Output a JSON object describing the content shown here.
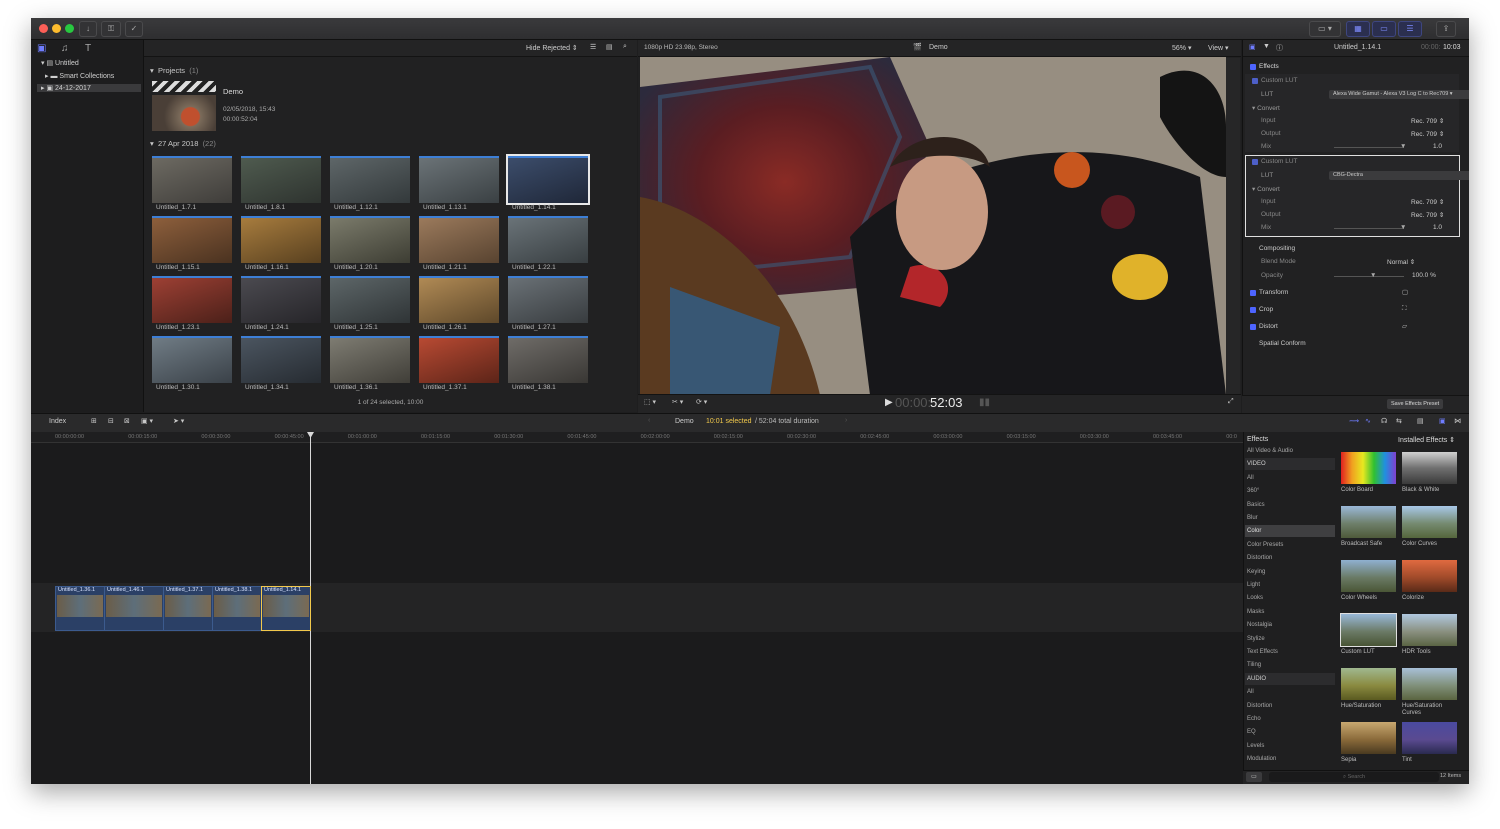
{
  "window": {
    "title": ""
  },
  "toolbar": {
    "import_icon": "download-icon",
    "keyword_icon": "key-icon",
    "check_icon": "checkmark-icon"
  },
  "library": {
    "items": [
      {
        "label": "Untitled"
      },
      {
        "label": "Smart Collections"
      },
      {
        "label": "24-12-2017"
      }
    ]
  },
  "browser": {
    "filter_label": "Hide Rejected",
    "projects_label": "Projects",
    "projects_count": "(1)",
    "project": {
      "name": "Demo",
      "date": "02/05/2018, 15:43",
      "duration": "00:00:52:04"
    },
    "date_group": "27 Apr 2018",
    "date_count": "(22)",
    "clips": [
      "Untitled_1.7.1",
      "Untitled_1.8.1",
      "Untitled_1.12.1",
      "Untitled_1.13.1",
      "Untitled_1.14.1",
      "Untitled_1.15.1",
      "Untitled_1.16.1",
      "Untitled_1.20.1",
      "Untitled_1.21.1",
      "Untitled_1.22.1",
      "Untitled_1.23.1",
      "Untitled_1.24.1",
      "Untitled_1.25.1",
      "Untitled_1.26.1",
      "Untitled_1.27.1",
      "Untitled_1.30.1",
      "Untitled_1.34.1",
      "Untitled_1.36.1",
      "Untitled_1.37.1",
      "Untitled_1.38.1"
    ],
    "selection_status": "1 of 24 selected, 10:00"
  },
  "viewer": {
    "format": "1080p HD 23.98p, Stereo",
    "title": "Demo",
    "zoom": "56%",
    "view_label": "View",
    "timecode_dim": "00:00:",
    "timecode": "52:03"
  },
  "inspector": {
    "clip_name": "Untitled_1.14.1",
    "clip_time_dim": "00:00:",
    "clip_time": "10:03",
    "effects_label": "Effects",
    "lut1": {
      "title": "Custom LUT",
      "lut_label": "LUT",
      "lut_value": "Alexa Wide Gamut - Alexa V3 Log C to Rec709",
      "convert": "Convert",
      "input_label": "Input",
      "input_value": "Rec. 709",
      "output_label": "Output",
      "output_value": "Rec. 709",
      "mix_label": "Mix",
      "mix_value": "1.0"
    },
    "lut2": {
      "title": "Custom LUT",
      "lut_label": "LUT",
      "lut_value": "CBG-Dectra",
      "convert": "Convert",
      "input_label": "Input",
      "input_value": "Rec. 709",
      "output_label": "Output",
      "output_value": "Rec. 709",
      "mix_label": "Mix",
      "mix_value": "1.0"
    },
    "compositing": "Compositing",
    "blend_label": "Blend Mode",
    "blend_value": "Normal",
    "opacity_label": "Opacity",
    "opacity_value": "100.0 %",
    "transform": "Transform",
    "crop": "Crop",
    "distort": "Distort",
    "spatial": "Spatial Conform",
    "save_preset": "Save Effects Preset"
  },
  "timeline": {
    "index_label": "Index",
    "project_name": "Demo",
    "selected": "10:01 selected",
    "total": "/ 52:04 total duration",
    "ruler": [
      "00:00:00:00",
      "00:00:15:00",
      "00:00:30:00",
      "00:00:45:00",
      "00:01:00:00",
      "00:01:15:00",
      "00:01:30:00",
      "00:01:45:00",
      "00:02:00:00",
      "00:02:15:00",
      "00:02:30:00",
      "00:02:45:00",
      "00:03:00:00",
      "00:03:15:00",
      "00:03:30:00",
      "00:03:45:00",
      "00:0"
    ],
    "clips": [
      "Untitled_1.36.1",
      "Untitled_1.46.1",
      "Untitled_1.37.1",
      "Untitled_1.38.1",
      "Untitled_1.14.1"
    ]
  },
  "effects": {
    "title": "Effects",
    "installed": "Installed Effects",
    "categories": [
      "All Video & Audio",
      "VIDEO",
      "All",
      "360°",
      "Basics",
      "Blur",
      "Color",
      "Color Presets",
      "Distortion",
      "Keying",
      "Light",
      "Looks",
      "Masks",
      "Nostalgia",
      "Stylize",
      "Text Effects",
      "Tiling",
      "AUDIO",
      "All",
      "Distortion",
      "Echo",
      "EQ",
      "Levels",
      "Modulation"
    ],
    "items": [
      "Color Board",
      "Black & White",
      "Broadcast Safe",
      "Color Curves",
      "Color Wheels",
      "Colorize",
      "Custom LUT",
      "HDR Tools",
      "Hue/Saturation",
      "Hue/Saturation Curves",
      "Sepia",
      "Tint"
    ],
    "search_placeholder": "Search",
    "count": "12 Items"
  }
}
